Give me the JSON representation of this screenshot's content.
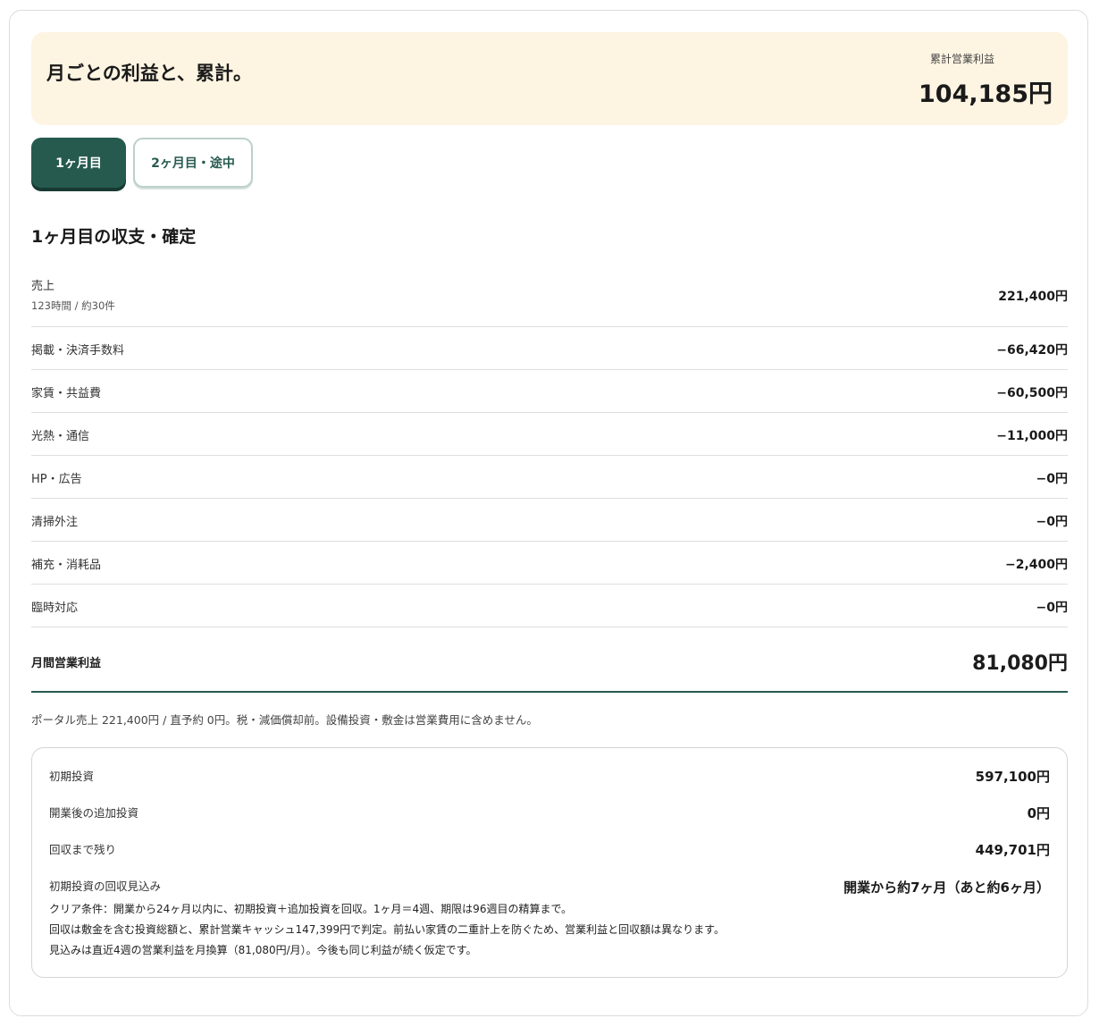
{
  "header": {
    "title": "月ごとの利益と、累計。",
    "cumulative_label": "累計営業利益",
    "cumulative_value": "104,185円"
  },
  "tabs": [
    {
      "label": "1ヶ月目",
      "active": true
    },
    {
      "label": "2ヶ月目・途中",
      "active": false
    }
  ],
  "section": {
    "title": "1ヶ月目の収支・確定"
  },
  "rows": [
    {
      "label": "売上",
      "sub": "123時間 / 約30件",
      "value": "221,400円"
    },
    {
      "label": "掲載・決済手数料",
      "value": "−66,420円"
    },
    {
      "label": "家賃・共益費",
      "value": "−60,500円"
    },
    {
      "label": "光熱・通信",
      "value": "−11,000円"
    },
    {
      "label": "HP・広告",
      "value": "−0円"
    },
    {
      "label": "清掃外注",
      "value": "−0円"
    },
    {
      "label": "補充・消耗品",
      "value": "−2,400円"
    },
    {
      "label": "臨時対応",
      "value": "−0円"
    }
  ],
  "total": {
    "label": "月間営業利益",
    "value": "81,080円"
  },
  "note": "ポータル売上 221,400円 / 直予約 0円。税・減価償却前。設備投資・敷金は営業費用に含めません。",
  "investment": {
    "items": [
      {
        "label": "初期投資",
        "value": "597,100円"
      },
      {
        "label": "開業後の追加投資",
        "value": "0円"
      },
      {
        "label": "回収まで残り",
        "value": "449,701円"
      },
      {
        "label": "初期投資の回収見込み",
        "value": "開業から約7ヶ月（あと約6ヶ月）"
      }
    ],
    "notes": [
      "クリア条件：開業から24ヶ月以内に、初期投資＋追加投資を回収。1ヶ月＝4週、期限は96週目の精算まで。",
      "回収は敷金を含む投資総額と、累計営業キャッシュ147,399円で判定。前払い家賃の二重計上を防ぐため、営業利益と回収額は異なります。",
      "見込みは直近4週の営業利益を月換算（81,080円/月）。今後も同じ利益が続く仮定です。"
    ]
  }
}
